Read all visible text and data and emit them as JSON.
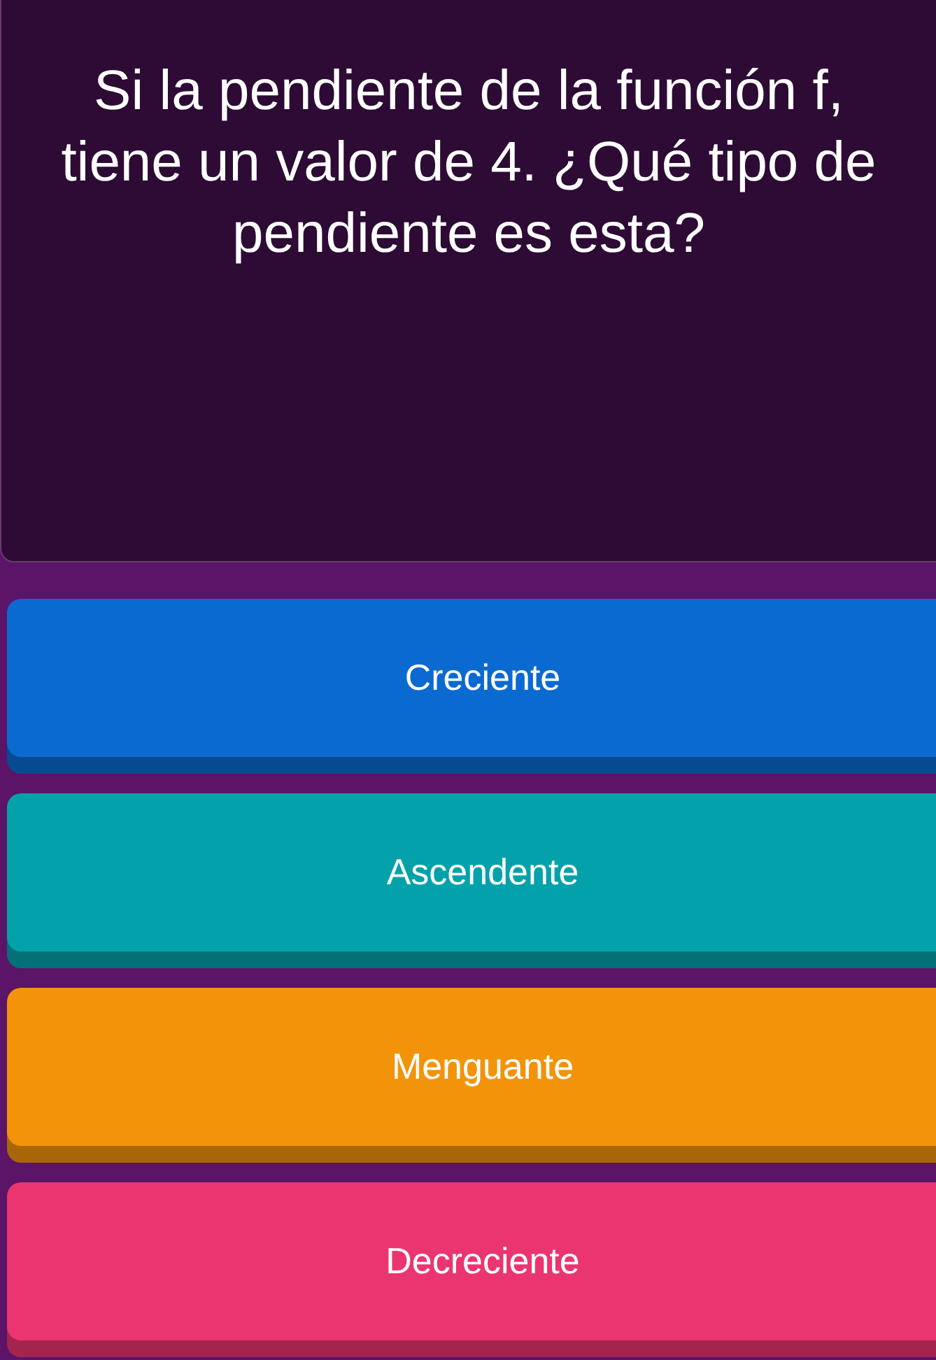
{
  "question": "Si la pendiente de la función f, tiene un valor de 4. ¿Qué tipo de pendiente es esta?",
  "options": [
    {
      "label": "Creciente",
      "color": "#0b6ad0"
    },
    {
      "label": "Ascendente",
      "color": "#03a2ab"
    },
    {
      "label": "Menguante",
      "color": "#f39309"
    },
    {
      "label": "Decreciente",
      "color": "#ea3570"
    }
  ]
}
